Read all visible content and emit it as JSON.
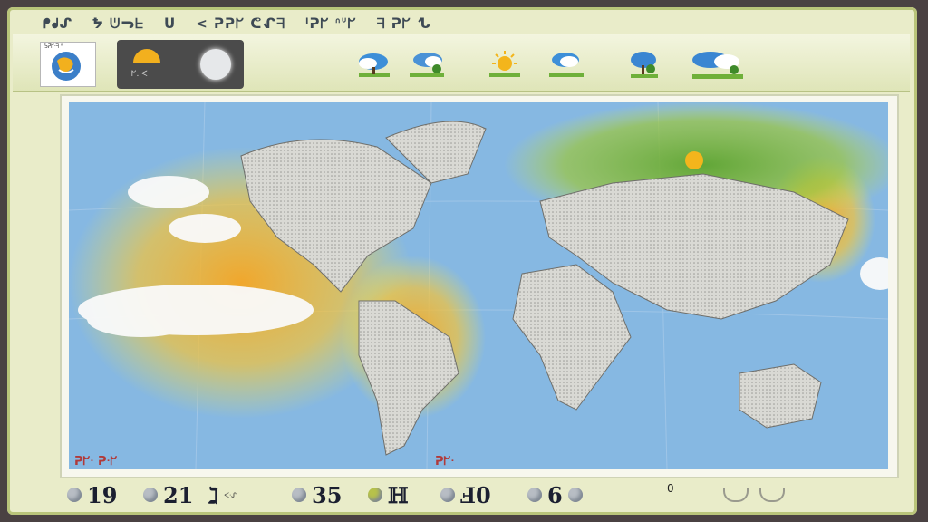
{
  "window": {
    "title_segments": [
      "ᖰᖱᔑ",
      "ᖬ ᕫᓓᖶ",
      "ᑌ",
      "< ᕈᕈᖸ ᕦᖋᖷ",
      "ᑊᕈᖸ ᐢᐡᖸ",
      "ᖷ ᕈᖸ ᖍ"
    ]
  },
  "toolbar": {
    "logo_text": "ᕊᕈᖸᐧᖷ ᐢ",
    "widget_readout": "ᖸ. ᐸᐧ",
    "forecast_icons": [
      "partly-cloudy-icon",
      "cloudy-island-icon",
      "sunny-icon",
      "cloudy-island-icon",
      "rain-tree-icon",
      "storm-icon"
    ]
  },
  "map": {
    "label_left": "ᕈᖸᐧ ᕈᐧᖸ",
    "label_bottom": "ᕈᖸᐧ"
  },
  "statusbar": {
    "stats": [
      {
        "value": "19",
        "unit": ""
      },
      {
        "value": "21",
        "unit": ""
      },
      {
        "value": "ℷ",
        "unit": "ᐸᐧᔑ"
      },
      {
        "value": "35",
        "unit": ""
      },
      {
        "value": "ℍ",
        "unit": ""
      },
      {
        "value": "Ⅎ0",
        "unit": ""
      },
      {
        "value": "6",
        "unit": ""
      }
    ],
    "zero_label": "0"
  },
  "colors": {
    "ocean": "#7fb3e0",
    "land": "#d7d7d2",
    "heat_orange": "#f6a623",
    "heat_yellow": "#f4e24a",
    "green": "#6fb03a"
  }
}
